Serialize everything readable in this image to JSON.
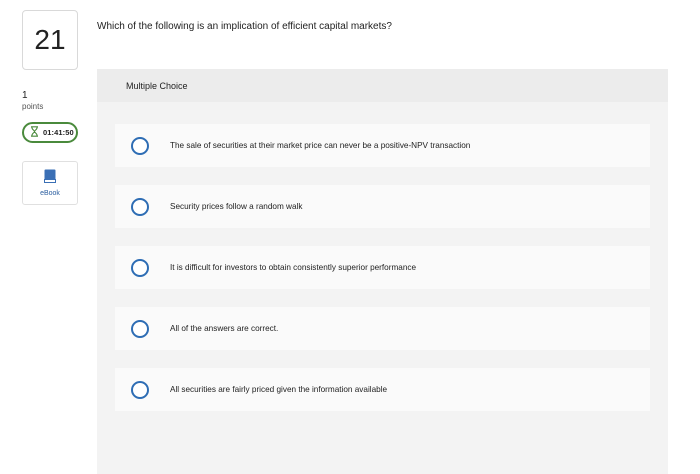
{
  "question_number": "21",
  "points": {
    "value": "1",
    "label": "points"
  },
  "timer": {
    "value": "01:41:50"
  },
  "ebook": {
    "label": "eBook"
  },
  "question_text": "Which of the following is an implication of efficient capital markets?",
  "answer_section": {
    "header": "Multiple Choice",
    "options": [
      {
        "label": "The sale of securities at their market price can never be a positive-NPV transaction"
      },
      {
        "label": "Security prices follow a random walk"
      },
      {
        "label": "It is difficult for investors to obtain consistently superior performance"
      },
      {
        "label": "All of the answers are correct."
      },
      {
        "label": "All securities are fairly priced given the information available"
      }
    ]
  },
  "colors": {
    "timer_border": "#4a8a3c",
    "radio_border": "#2e6db4",
    "ebook_icon": "#3a6fb5"
  }
}
